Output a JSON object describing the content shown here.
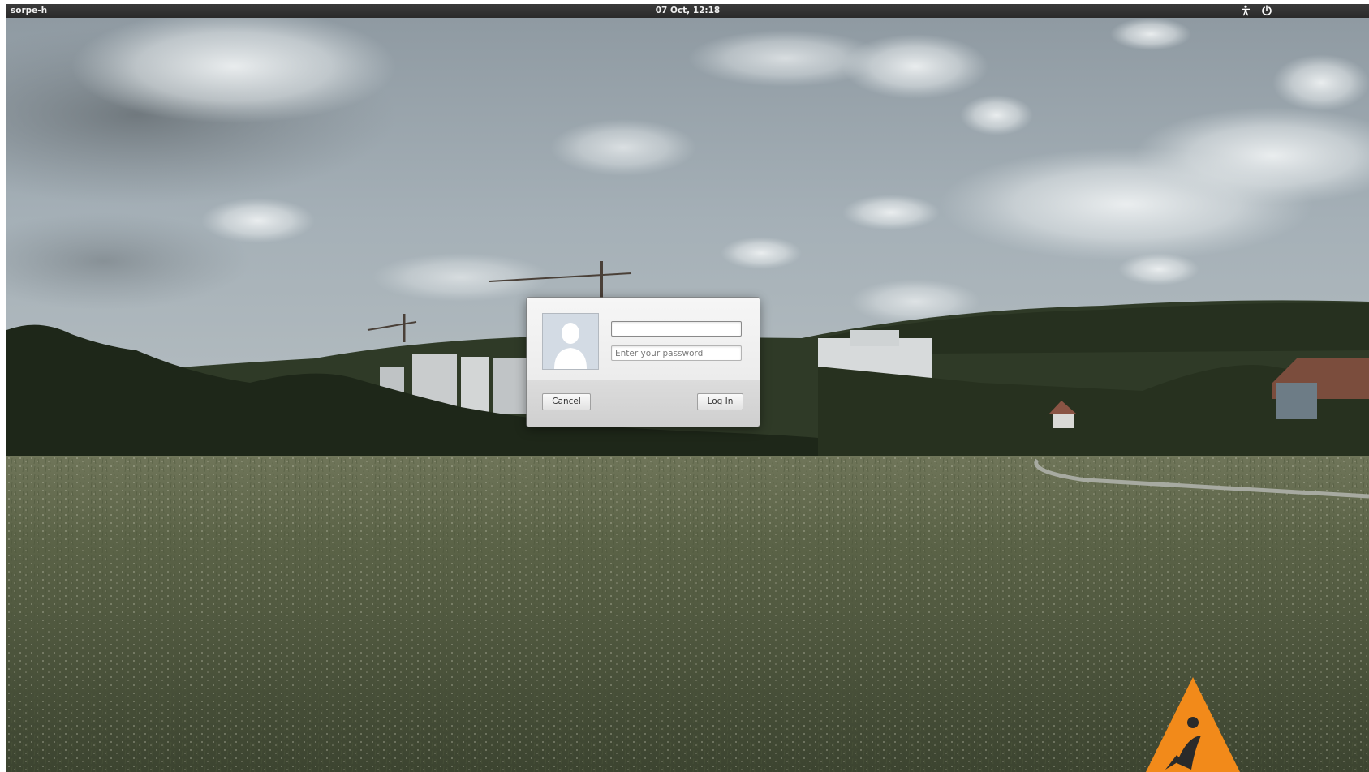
{
  "top_panel": {
    "host_name": "sorpe-h",
    "clock": "07 Oct, 12:18",
    "right_icons": [
      "accessibility-icon",
      "power-icon"
    ]
  },
  "login_dialog": {
    "avatar": "default-user-avatar-icon",
    "username": {
      "value": "",
      "placeholder": ""
    },
    "password": {
      "value": "",
      "placeholder": "Enter your password"
    },
    "cancel_label": "Cancel",
    "login_label": "Log In"
  },
  "colors": {
    "panel_bg": "#2e2e2e",
    "dialog_bg": "#f2f2f2",
    "logo_orange": "#f28a1a"
  }
}
